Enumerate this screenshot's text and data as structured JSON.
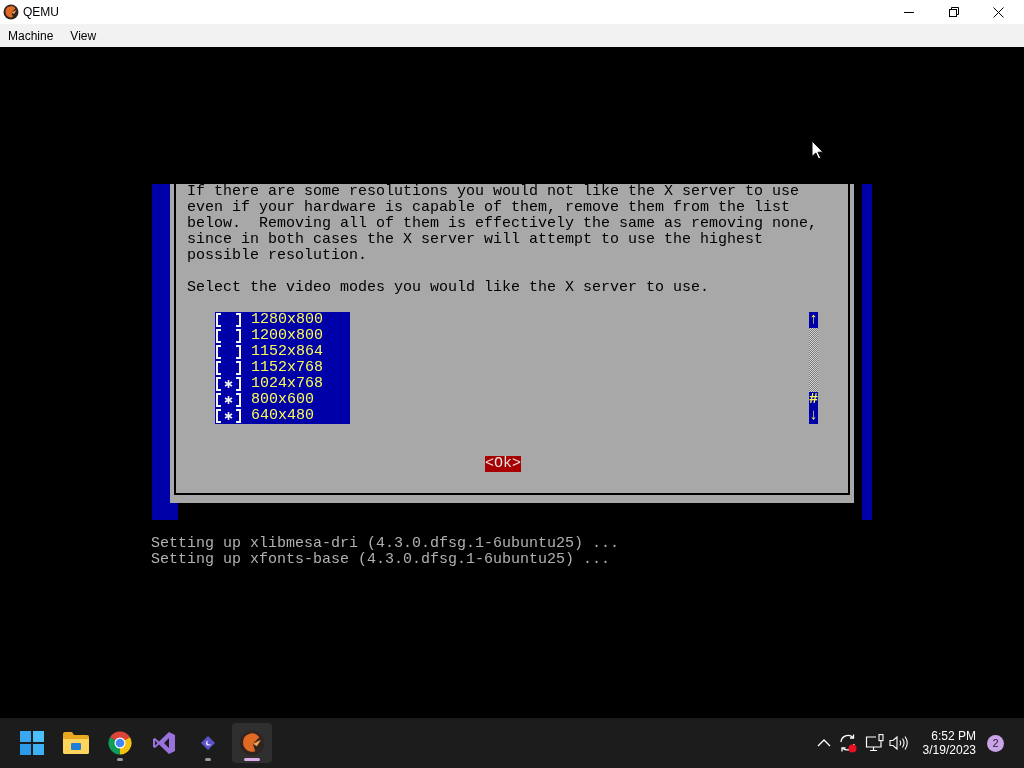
{
  "window": {
    "title": "QEMU"
  },
  "menu": [
    {
      "label": "Machine"
    },
    {
      "label": "View"
    }
  ],
  "dialog": {
    "message": "If there are some resolutions you would not like the X server to use even if your hardware is capable of them, remove them from the list below.  Removing all of them is effectively the same as removing none, since in both cases the X server will attempt to use the highest possible resolution.",
    "prompt": "Select the video modes you would like the X server to use.",
    "modes": [
      {
        "label": "1280x800",
        "checked": false
      },
      {
        "label": "1200x800",
        "checked": false
      },
      {
        "label": "1152x864",
        "checked": false
      },
      {
        "label": "1152x768",
        "checked": false
      },
      {
        "label": "1024x768",
        "checked": true
      },
      {
        "label": "800x600",
        "checked": true
      },
      {
        "label": "640x480",
        "checked": true
      }
    ],
    "scrollbar": {
      "up": "↑",
      "thumb": "#",
      "down": "↓"
    },
    "button": {
      "label": "<Ok>",
      "selected": true
    }
  },
  "console": [
    "Setting up xlibmesa-dri (4.3.0.dfsg.1-6ubuntu25) ...",
    "Setting up xfonts-base (4.3.0.dfsg.1-6ubuntu25) ..."
  ],
  "taskbar": {
    "apps": [
      {
        "kind": "folder",
        "running": false,
        "active": false
      },
      {
        "kind": "browser",
        "running": true,
        "active": false
      },
      {
        "kind": "editor",
        "running": false,
        "active": false
      },
      {
        "kind": "chat",
        "running": true,
        "active": false
      },
      {
        "kind": "emulator",
        "running": true,
        "active": true
      }
    ],
    "tray": {
      "time": "6:52 PM",
      "date": "3/19/2023",
      "notifications": "2"
    }
  }
}
